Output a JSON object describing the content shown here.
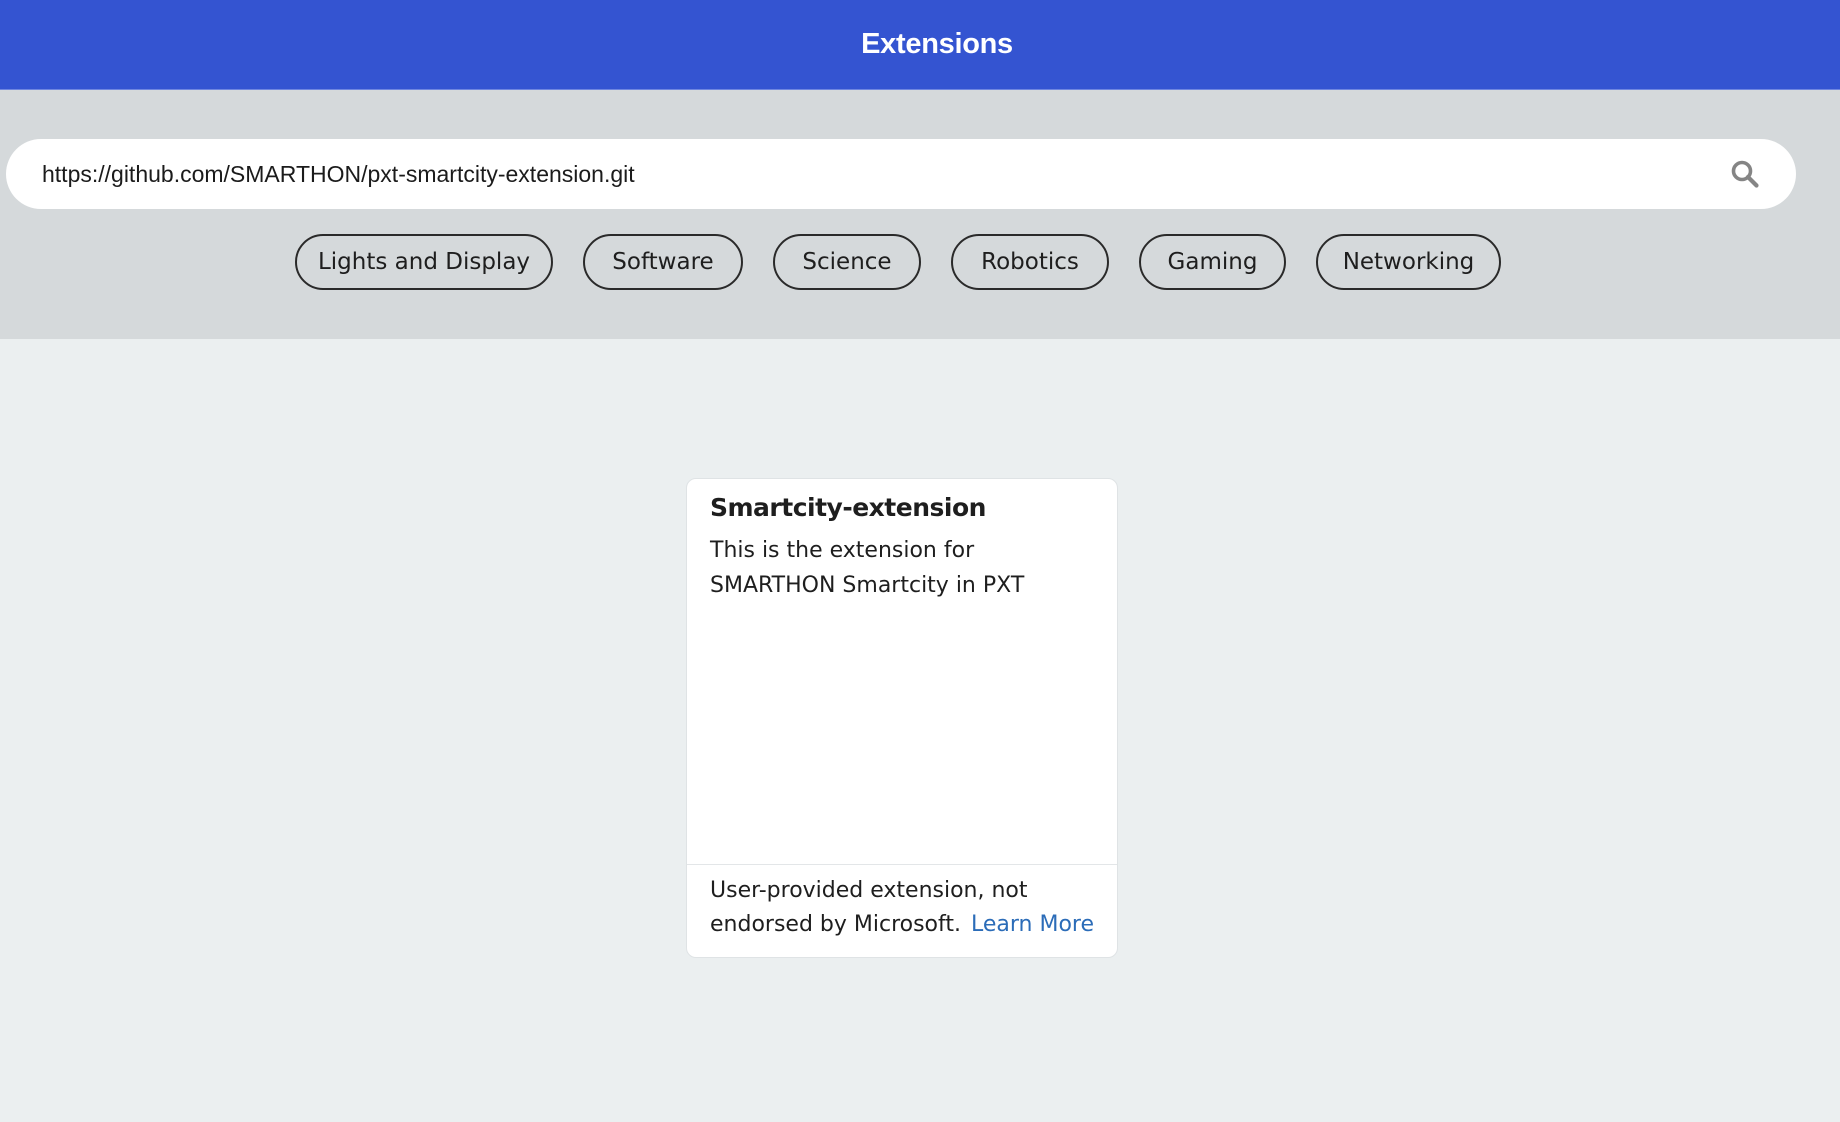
{
  "header": {
    "title": "Extensions"
  },
  "search": {
    "value": "https://github.com/SMARTHON/pxt-smartcity-extension.git",
    "icon": "search-icon"
  },
  "categories": [
    {
      "label": "Lights and Display"
    },
    {
      "label": "Software"
    },
    {
      "label": "Science"
    },
    {
      "label": "Robotics"
    },
    {
      "label": "Gaming"
    },
    {
      "label": "Networking"
    }
  ],
  "result_card": {
    "title": "Smartcity-extension",
    "description": "This is the extension for SMARTHON Smartcity in PXT",
    "footer_text": "User-provided extension, not endorsed by Microsoft.",
    "learn_more": "Learn More"
  },
  "colors": {
    "header_bg": "#3454d1",
    "search_area_bg": "#d5d9db",
    "page_bg": "#ebeff0",
    "link": "#2b6cb8"
  }
}
